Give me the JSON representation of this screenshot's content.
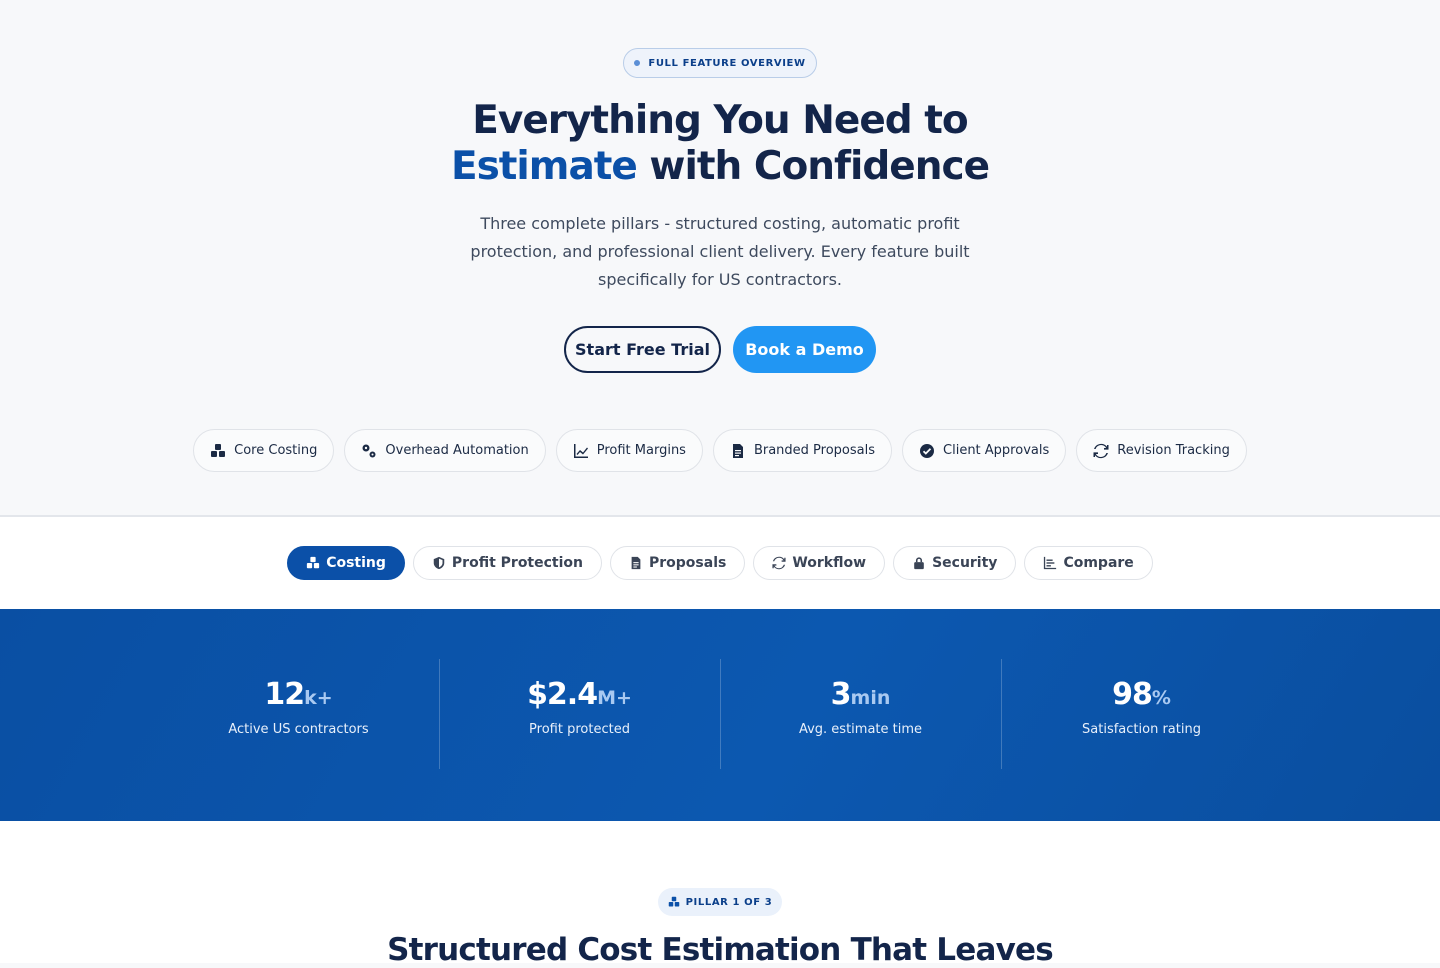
{
  "hero": {
    "badge": "FULL FEATURE OVERVIEW",
    "title_line1": "Everything You Need to",
    "title_accent": "Estimate",
    "title_rest": " with Confidence",
    "subtitle": "Three complete pillars - structured costing, automatic profit protection, and professional client delivery. Every feature built specifically for US contractors.",
    "cta_trial": "Start Free Trial",
    "cta_demo": "Book a Demo",
    "features": [
      {
        "label": "Core Costing",
        "icon": "cubes-icon"
      },
      {
        "label": "Overhead Automation",
        "icon": "cogs-icon"
      },
      {
        "label": "Profit Margins",
        "icon": "line-chart-icon"
      },
      {
        "label": "Branded Proposals",
        "icon": "document-icon"
      },
      {
        "label": "Client Approvals",
        "icon": "check-circle-icon"
      },
      {
        "label": "Revision Tracking",
        "icon": "refresh-icon"
      }
    ]
  },
  "tabs": [
    {
      "label": "Costing",
      "icon": "cubes-icon",
      "active": true
    },
    {
      "label": "Profit Protection",
      "icon": "shield-icon"
    },
    {
      "label": "Proposals",
      "icon": "document-icon"
    },
    {
      "label": "Workflow",
      "icon": "refresh-icon"
    },
    {
      "label": "Security",
      "icon": "lock-icon"
    },
    {
      "label": "Compare",
      "icon": "bar-chart-icon"
    }
  ],
  "stats": [
    {
      "value": "12",
      "unit": "k+",
      "label": "Active US contractors"
    },
    {
      "value": "$2.4",
      "unit": "M+",
      "label": "Profit protected"
    },
    {
      "value": "3",
      "unit": "min",
      "label": "Avg. estimate time"
    },
    {
      "value": "98",
      "unit": "%",
      "label": "Satisfaction rating"
    }
  ],
  "pillar": {
    "badge": "PILLAR 1 OF 3",
    "title": "Structured Cost Estimation That Leaves"
  },
  "colors": {
    "navy": "#13254a",
    "accent_blue": "#0b50a8",
    "cta_blue": "#2196f3",
    "stats_bg": "#0b52a8"
  }
}
